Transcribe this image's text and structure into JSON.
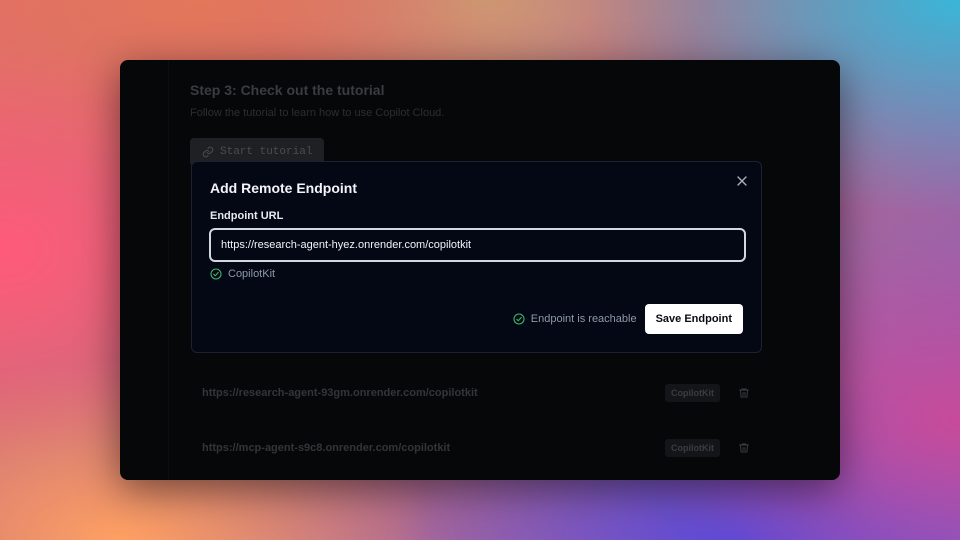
{
  "background_page": {
    "step_title": "Step 3: Check out the tutorial",
    "step_description": "Follow the tutorial to learn how to use Copilot Cloud.",
    "tutorial_button_label": "Start tutorial",
    "endpoints": [
      {
        "url": "https://research-agent-93gm.onrender.com/copilotkit",
        "tag": "CopilotKit"
      },
      {
        "url": "https://mcp-agent-s9c8.onrender.com/copilotkit",
        "tag": "CopilotKit"
      }
    ]
  },
  "modal": {
    "title": "Add Remote Endpoint",
    "field_label": "Endpoint URL",
    "url_value": "https://research-agent-hyez.onrender.com/copilotkit",
    "detected_type": "CopilotKit",
    "status_text": "Endpoint is reachable",
    "save_label": "Save Endpoint"
  },
  "colors": {
    "success": "#3fb46b",
    "modal_bg": "#040814",
    "window_bg": "#060708"
  },
  "icons": {
    "close": "close-icon",
    "check": "check-circle-icon",
    "link": "link-icon",
    "trash": "trash-icon"
  }
}
